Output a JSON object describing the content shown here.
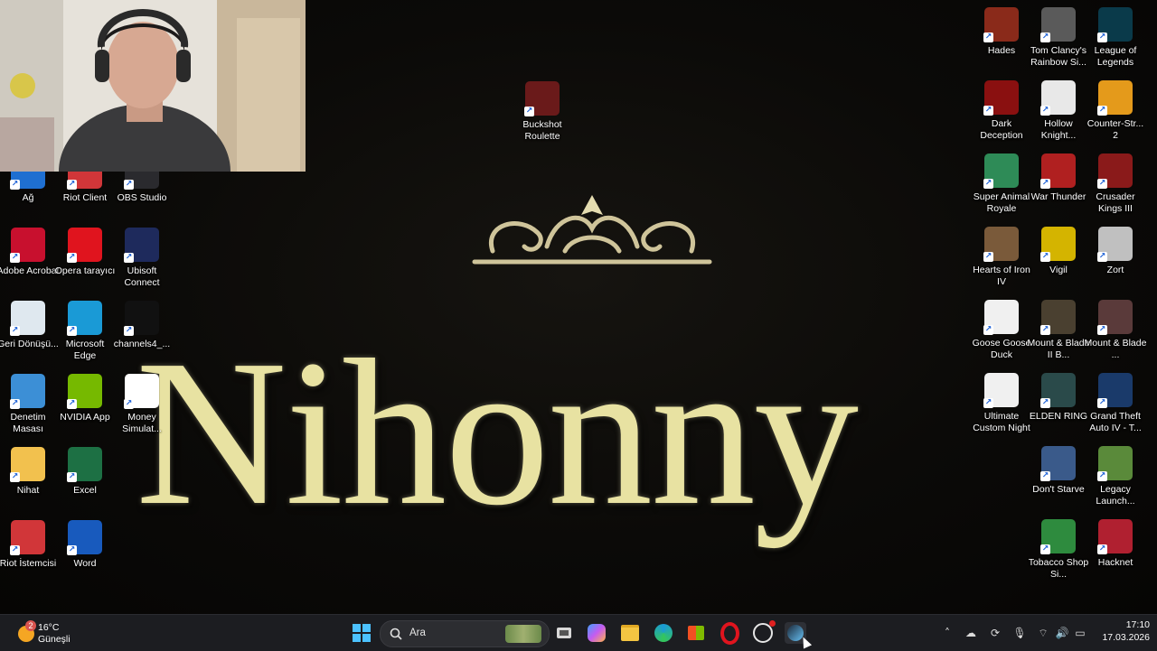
{
  "wallpaper": {
    "title": "Nihonny",
    "colors": {
      "text": "#e8e2a2",
      "background": "#0b0a08"
    }
  },
  "desktop_icons_left": [
    {
      "label": "Ağ",
      "icon": "network-icon",
      "color": "#1f6fd1"
    },
    {
      "label": "Riot Client",
      "icon": "riot-client-icon",
      "color": "#d13639"
    },
    {
      "label": "OBS Studio",
      "icon": "obs-studio-icon",
      "color": "#2a2a2e"
    },
    {
      "label": "Adobe Acrobat",
      "icon": "adobe-acrobat-icon",
      "color": "#c8102e"
    },
    {
      "label": "Opera tarayıcı",
      "icon": "opera-icon",
      "color": "#e0141e"
    },
    {
      "label": "Ubisoft Connect",
      "icon": "ubisoft-icon",
      "color": "#1e2a5c"
    },
    {
      "label": "Geri Dönüşü...",
      "icon": "recycle-bin-icon",
      "color": "#dfe8ef"
    },
    {
      "label": "Microsoft Edge",
      "icon": "edge-icon",
      "color": "#1a9ad6"
    },
    {
      "label": "channels4_...",
      "icon": "image-file-icon",
      "color": "#111111"
    },
    {
      "label": "Denetim Masası",
      "icon": "control-panel-icon",
      "color": "#3c8fd6"
    },
    {
      "label": "NVIDIA App",
      "icon": "nvidia-icon",
      "color": "#76b900"
    },
    {
      "label": "Money Simulat...",
      "icon": "document-icon",
      "color": "#ffffff"
    },
    {
      "label": "Nihat",
      "icon": "user-folder-icon",
      "color": "#f2c14e"
    },
    {
      "label": "Excel",
      "icon": "excel-icon",
      "color": "#1d7044"
    },
    {
      "label": "Riot İstemcisi",
      "icon": "riot-client-icon",
      "color": "#d13639"
    },
    {
      "label": "Word",
      "icon": "word-icon",
      "color": "#185abd"
    }
  ],
  "desktop_icons_center": [
    {
      "label": "Buckshot Roulette",
      "icon": "buckshot-roulette-icon",
      "color": "#6a1a1a"
    }
  ],
  "desktop_icons_right": [
    {
      "label": "Hades",
      "icon": "hades-icon",
      "color": "#8a2a1a"
    },
    {
      "label": "Tom Clancy's Rainbow Si...",
      "icon": "rainbow-six-icon",
      "color": "#5a5a5a"
    },
    {
      "label": "League of Legends",
      "icon": "league-of-legends-icon",
      "color": "#0a3a4a"
    },
    {
      "label": "Dark Deception",
      "icon": "dark-deception-icon",
      "color": "#8a1010"
    },
    {
      "label": "Hollow Knight...",
      "icon": "hollow-knight-icon",
      "color": "#e8e8e8"
    },
    {
      "label": "Counter-Str... 2",
      "icon": "counter-strike-icon",
      "color": "#e49a1b"
    },
    {
      "label": "Super Animal Royale",
      "icon": "super-animal-royale-icon",
      "color": "#2e8b57"
    },
    {
      "label": "War Thunder",
      "icon": "war-thunder-icon",
      "color": "#b02020"
    },
    {
      "label": "Crusader Kings III",
      "icon": "crusader-kings-icon",
      "color": "#8a1a1a"
    },
    {
      "label": "Hearts of Iron IV",
      "icon": "hearts-of-iron-icon",
      "color": "#7a5a3a"
    },
    {
      "label": "Vigil",
      "icon": "vigil-icon",
      "color": "#d4b400"
    },
    {
      "label": "Zort",
      "icon": "zort-icon",
      "color": "#c0c0c0"
    },
    {
      "label": "Goose Goose Duck",
      "icon": "goose-goose-duck-icon",
      "color": "#f0f0f0"
    },
    {
      "label": "Mount & Blade II B...",
      "icon": "mount-blade-icon",
      "color": "#4a4030"
    },
    {
      "label": "Mount & Blade ...",
      "icon": "mount-blade-icon",
      "color": "#5a3a3a"
    },
    {
      "label": "Ultimate Custom Night",
      "icon": "ultimate-custom-night-icon",
      "color": "#f0f0f0"
    },
    {
      "label": "ELDEN RING",
      "icon": "elden-ring-icon",
      "color": "#2a4a4a"
    },
    {
      "label": "Grand Theft Auto IV - T...",
      "icon": "gta-iv-icon",
      "color": "#1a3a6a"
    },
    {
      "label": "Don't Starve",
      "icon": "dont-starve-icon",
      "color": "#3a5a8a"
    },
    {
      "label": "Legacy Launch...",
      "icon": "minecraft-legacy-icon",
      "color": "#5a8a3a"
    },
    {
      "label": "Tobacco Shop Si...",
      "icon": "tobacco-shop-icon",
      "color": "#2e8b3e"
    },
    {
      "label": "Hacknet",
      "icon": "hacknet-icon",
      "color": "#b02030"
    }
  ],
  "taskbar": {
    "weather": {
      "temp": "16°C",
      "condition": "Güneşli",
      "badge": "2"
    },
    "search_placeholder": "Ara",
    "time": "17:10",
    "date": "17.03.2026"
  }
}
